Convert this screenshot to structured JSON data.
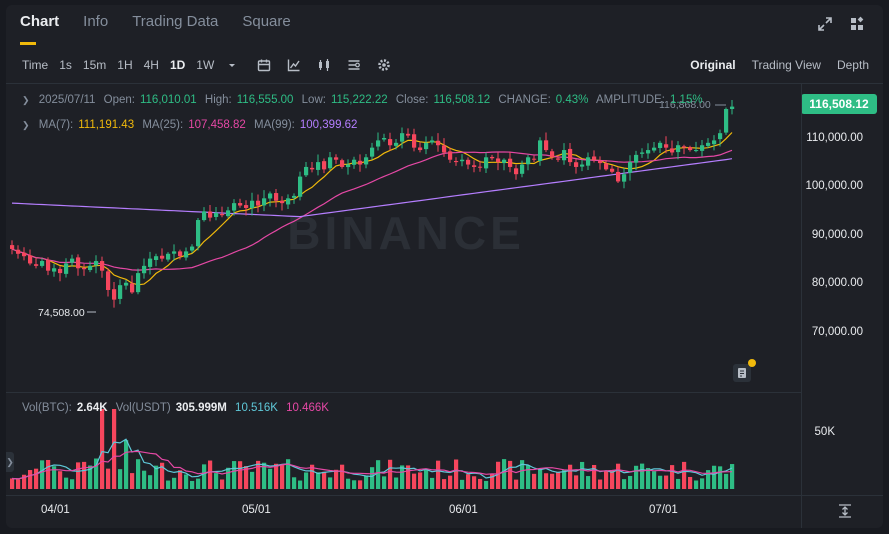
{
  "tabs": [
    "Chart",
    "Info",
    "Trading Data",
    "Square"
  ],
  "toolbar": {
    "timeframes": [
      "Time",
      "1s",
      "15m",
      "1H",
      "4H",
      "1D",
      "1W"
    ],
    "active_timeframe": "1D",
    "views": [
      "Original",
      "Trading View",
      "Depth"
    ],
    "active_view": "Original"
  },
  "ohlc": {
    "date": "2025/07/11",
    "open_label": "Open:",
    "open": "116,010.01",
    "high_label": "High:",
    "high": "116,555.00",
    "low_label": "Low:",
    "low": "115,222.22",
    "close_label": "Close:",
    "close": "116,508.12",
    "change_label": "CHANGE:",
    "change": "0.43%",
    "amplitude_label": "AMPLITUDE:",
    "amplitude": "1.15%"
  },
  "ma": {
    "ma7_label": "MA(7):",
    "ma7": "111,191.43",
    "ma25_label": "MA(25):",
    "ma25": "107,458.82",
    "ma99_label": "MA(99):",
    "ma99": "100,399.62"
  },
  "volume": {
    "btc_label": "Vol(BTC):",
    "btc": "2.64K",
    "usdt_label": "Vol(USDT)",
    "usdt": "305.999M",
    "ma1": "10.516K",
    "ma2": "10.466K"
  },
  "current_price": "116,508.12",
  "high_marker": "116,868.00",
  "low_marker": "74,508.00",
  "watermark": "BINANCE",
  "price_axis": [
    "110,000.00",
    "100,000.00",
    "90,000.00",
    "80,000.00",
    "70,000.00"
  ],
  "volume_axis": [
    "50K"
  ],
  "date_axis": [
    "04/01",
    "05/01",
    "06/01",
    "07/01"
  ],
  "colors": {
    "up": "#2ebd85",
    "down": "#f6465d",
    "ma7": "#f0b90b",
    "ma25": "#e548a5",
    "ma99": "#b57eff",
    "accent": "#f0b90b"
  },
  "chart_data": {
    "type": "candlestick",
    "ylim": [
      60000,
      120000
    ],
    "series": [
      {
        "name": "MA(7)",
        "current": 111191.43
      },
      {
        "name": "MA(25)",
        "current": 107458.82
      },
      {
        "name": "MA(99)",
        "current": 100399.62
      }
    ],
    "closes_approx": [
      87000,
      86000,
      85500,
      84000,
      83500,
      84500,
      82500,
      83000,
      82000,
      84000,
      85000,
      83000,
      82800,
      83500,
      84500,
      82500,
      78500,
      76500,
      79500,
      80000,
      78000,
      82000,
      83500,
      85000,
      85500,
      85000,
      86000,
      86500,
      85500,
      86500,
      87500,
      93000,
      94800,
      93500,
      94500,
      94000,
      95000,
      96500,
      96000,
      95500,
      97000,
      96000,
      97500,
      98500,
      97000,
      96500,
      97500,
      98000,
      102000,
      104000,
      103500,
      105000,
      103500,
      106000,
      105500,
      104000,
      104500,
      105500,
      104500,
      106000,
      108000,
      109500,
      110000,
      108500,
      109000,
      111000,
      110500,
      108000,
      107500,
      109000,
      109500,
      108500,
      107000,
      105500,
      105000,
      105500,
      104500,
      104000,
      104000,
      106000,
      105800,
      105000,
      105500,
      104000,
      102500,
      104500,
      106000,
      105500,
      109500,
      107500,
      106000,
      105500,
      107500,
      105000,
      104000,
      104500,
      106000,
      105500,
      104800,
      103500,
      103000,
      101000,
      102500,
      105000,
      106500,
      107000,
      107500,
      108000,
      109000,
      108000,
      107000,
      108500,
      108000,
      107500,
      107500,
      108500,
      109000,
      109500,
      111000,
      116008,
      116508
    ]
  }
}
